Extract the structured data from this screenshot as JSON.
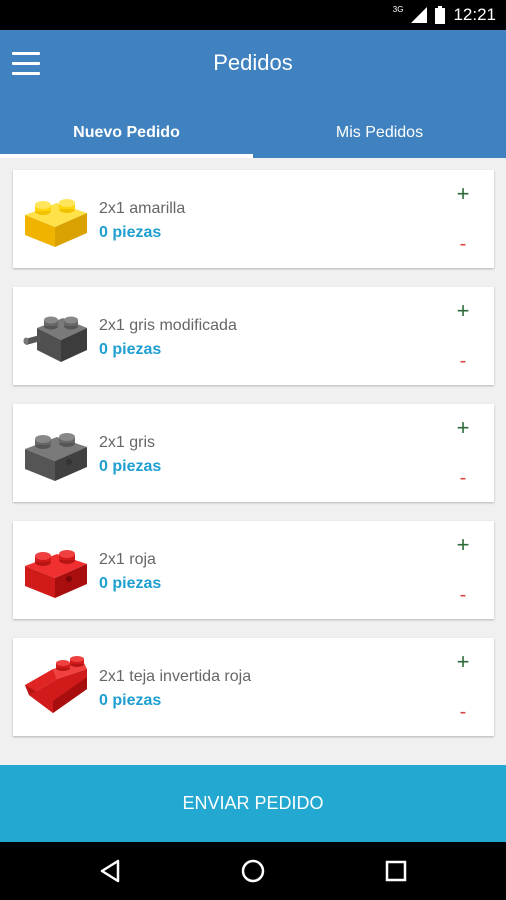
{
  "status_bar": {
    "network": "3G",
    "time": "12:21"
  },
  "app_bar": {
    "title": "Pedidos",
    "menu_icon": "hamburger-menu-icon"
  },
  "tabs": [
    {
      "label": "Nuevo Pedido",
      "active": true
    },
    {
      "label": "Mis Pedidos",
      "active": false
    }
  ],
  "items": [
    {
      "name": "2x1 amarilla",
      "qty": "0 piezas",
      "plus": "+",
      "minus": "-",
      "brick_color": "#f4c20d",
      "icon": "yellow-brick-icon"
    },
    {
      "name": "2x1 gris modificada",
      "qty": "0 piezas",
      "plus": "+",
      "minus": "-",
      "brick_color": "#555555",
      "icon": "grey-modified-brick-icon"
    },
    {
      "name": "2x1 gris",
      "qty": "0 piezas",
      "plus": "+",
      "minus": "-",
      "brick_color": "#5a5a5a",
      "icon": "grey-brick-icon"
    },
    {
      "name": "2x1 roja",
      "qty": "0 piezas",
      "plus": "+",
      "minus": "-",
      "brick_color": "#d11a1a",
      "icon": "red-brick-icon"
    },
    {
      "name": "2x1 teja invertida roja",
      "qty": "0 piezas",
      "plus": "+",
      "minus": "-",
      "brick_color": "#d11a1a",
      "icon": "red-inverted-slope-brick-icon"
    }
  ],
  "send_button": {
    "label": "ENVIAR PEDIDO"
  },
  "colors": {
    "primary": "#3f82bf",
    "accent": "#23a8d1",
    "plus": "#2f6b3a",
    "minus": "#d84444",
    "qty": "#1e9fd0"
  }
}
